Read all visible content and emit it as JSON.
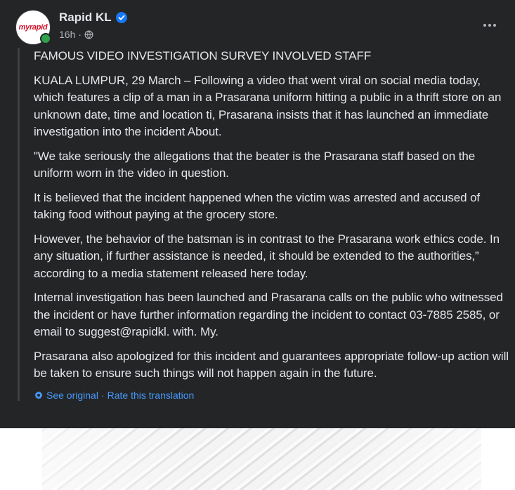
{
  "post": {
    "author": "Rapid KL",
    "avatar_text": "myrapid",
    "time": "16h",
    "time_separator": "·",
    "paragraphs": [
      "FAMOUS VIDEO INVESTIGATION SURVEY INVOLVED STAFF",
      "KUALA LUMPUR, 29 March – Following a video that went viral on social media today, which features a clip of a man in a Prasarana uniform hitting a public in a thrift store on an unknown date, time and location ti, Prasarana insists that it has launched an immediate investigation into the incident About.",
      "\"We take seriously the allegations that the beater is the Prasarana staff based on the uniform worn in the video in question.",
      "It is believed that the incident happened when the victim was arrested and accused of taking food without paying at the grocery store.",
      "However, the behavior of the batsman is in contrast to the Prasarana work ethics code. In any situation, if further assistance is needed, it should be extended to the authorities,” according to a media statement released here today.",
      "Internal investigation has been launched and Prasarana calls on the public who witnessed the incident or have further information regarding the incident to contact 03-7885 2585, or email to suggest@rapidkl. with. My.",
      "Prasarana also apologized for this incident and guarantees appropriate follow-up action will be taken to ensure such things will not happen again in the future."
    ],
    "translation": {
      "see_original": "See original",
      "separator": "·",
      "rate": "Rate this translation"
    }
  },
  "icons": {
    "verified": "verified-badge-icon",
    "globe": "globe-icon",
    "more": "more-options-icon",
    "gear": "gear-icon"
  },
  "colors": {
    "background": "#242526",
    "text": "#e4e6eb",
    "secondary": "#b0b3b8",
    "link": "#4599ff",
    "verified": "#1877f2",
    "online": "#31a24c"
  }
}
